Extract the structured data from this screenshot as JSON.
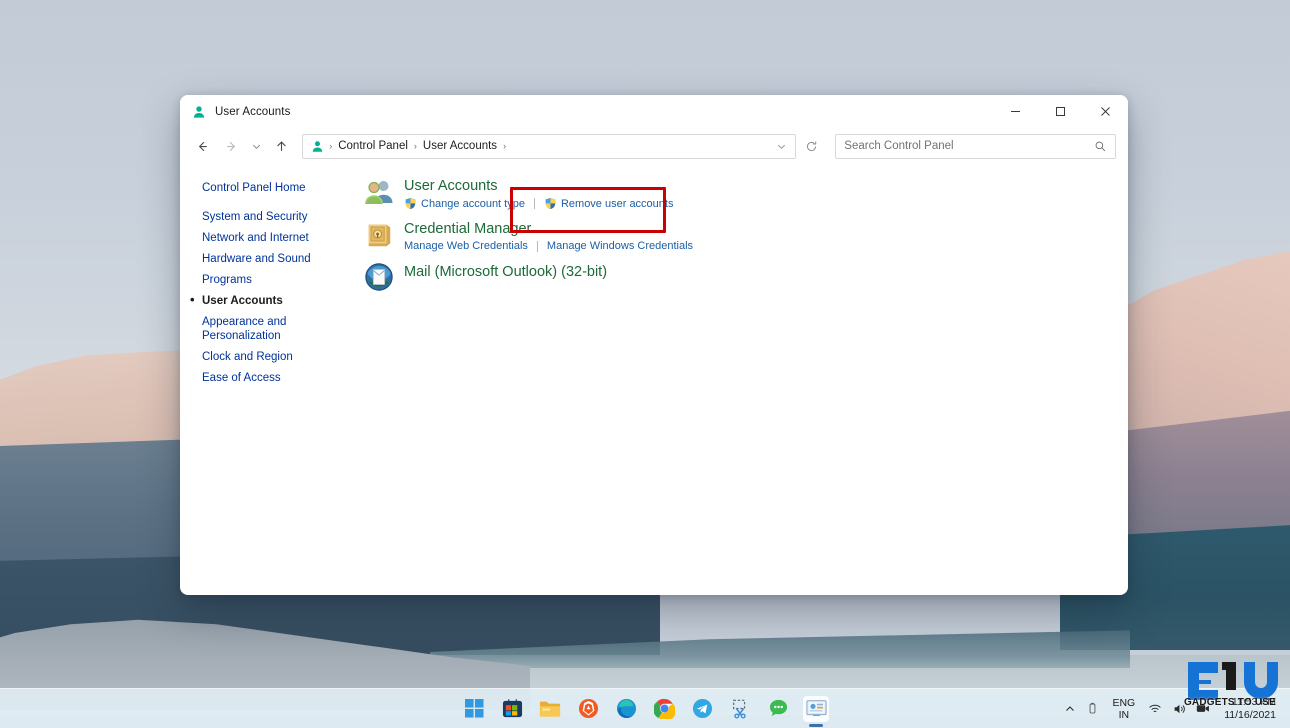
{
  "window": {
    "title": "User Accounts",
    "app_icon": "user-icon",
    "controls": {
      "minimize": "─",
      "maximize": "□",
      "close": "✕"
    }
  },
  "nav": {
    "back": "back-arrow",
    "forward": "forward-arrow",
    "recent": "chevron-down",
    "up": "up-arrow",
    "breadcrumbs": [
      "Control Panel",
      "User Accounts"
    ],
    "separator": "›",
    "dropdown": "chevron-down-icon",
    "refresh": "refresh-icon"
  },
  "search": {
    "placeholder": "Search Control Panel",
    "value": "",
    "icon": "search-icon"
  },
  "sidebar": {
    "home": "Control Panel Home",
    "items": [
      {
        "label": "System and Security",
        "current": false
      },
      {
        "label": "Network and Internet",
        "current": false
      },
      {
        "label": "Hardware and Sound",
        "current": false
      },
      {
        "label": "Programs",
        "current": false
      },
      {
        "label": "User Accounts",
        "current": true
      },
      {
        "label": "Appearance and Personalization",
        "current": false
      },
      {
        "label": "Clock and Region",
        "current": false
      },
      {
        "label": "Ease of Access",
        "current": false
      }
    ]
  },
  "content": {
    "categories": [
      {
        "title": "User Accounts",
        "icon": "user-accounts-icon",
        "links": [
          {
            "label": "Change account type",
            "shield": true
          },
          {
            "label": "Remove user accounts",
            "shield": true
          }
        ]
      },
      {
        "title": "Credential Manager",
        "icon": "credential-manager-icon",
        "links": [
          {
            "label": "Manage Web Credentials",
            "shield": false
          },
          {
            "label": "Manage Windows Credentials",
            "shield": false
          }
        ]
      },
      {
        "title": "Mail (Microsoft Outlook) (32-bit)",
        "icon": "mail-outlook-icon",
        "links": []
      }
    ]
  },
  "annotation": {
    "color": "#cc0000",
    "target": "Remove user accounts"
  },
  "taskbar": {
    "items": [
      {
        "name": "start-button",
        "active": false,
        "running": false
      },
      {
        "name": "microsoft-store-icon",
        "active": false,
        "running": false
      },
      {
        "name": "file-explorer-icon",
        "active": false,
        "running": false
      },
      {
        "name": "brave-browser-icon",
        "active": false,
        "running": false
      },
      {
        "name": "microsoft-edge-icon",
        "active": false,
        "running": true
      },
      {
        "name": "google-chrome-icon",
        "active": false,
        "running": false
      },
      {
        "name": "telegram-icon",
        "active": false,
        "running": false
      },
      {
        "name": "snipping-tool-icon",
        "active": false,
        "running": true
      },
      {
        "name": "chat-icon",
        "active": false,
        "running": true
      },
      {
        "name": "control-panel-icon",
        "active": true,
        "running": true
      }
    ],
    "tray": {
      "overflow": "chevron-up-icon",
      "battery": "battery-icon",
      "language_primary": "ENG",
      "language_secondary": "IN",
      "wifi": "wifi-icon",
      "volume": "volume-icon",
      "camera": "camera-icon",
      "time": "11:53 PM",
      "date": "11/16/2021"
    }
  },
  "watermark": {
    "text": "GADGETS TO USE",
    "color": "#1673d6"
  }
}
